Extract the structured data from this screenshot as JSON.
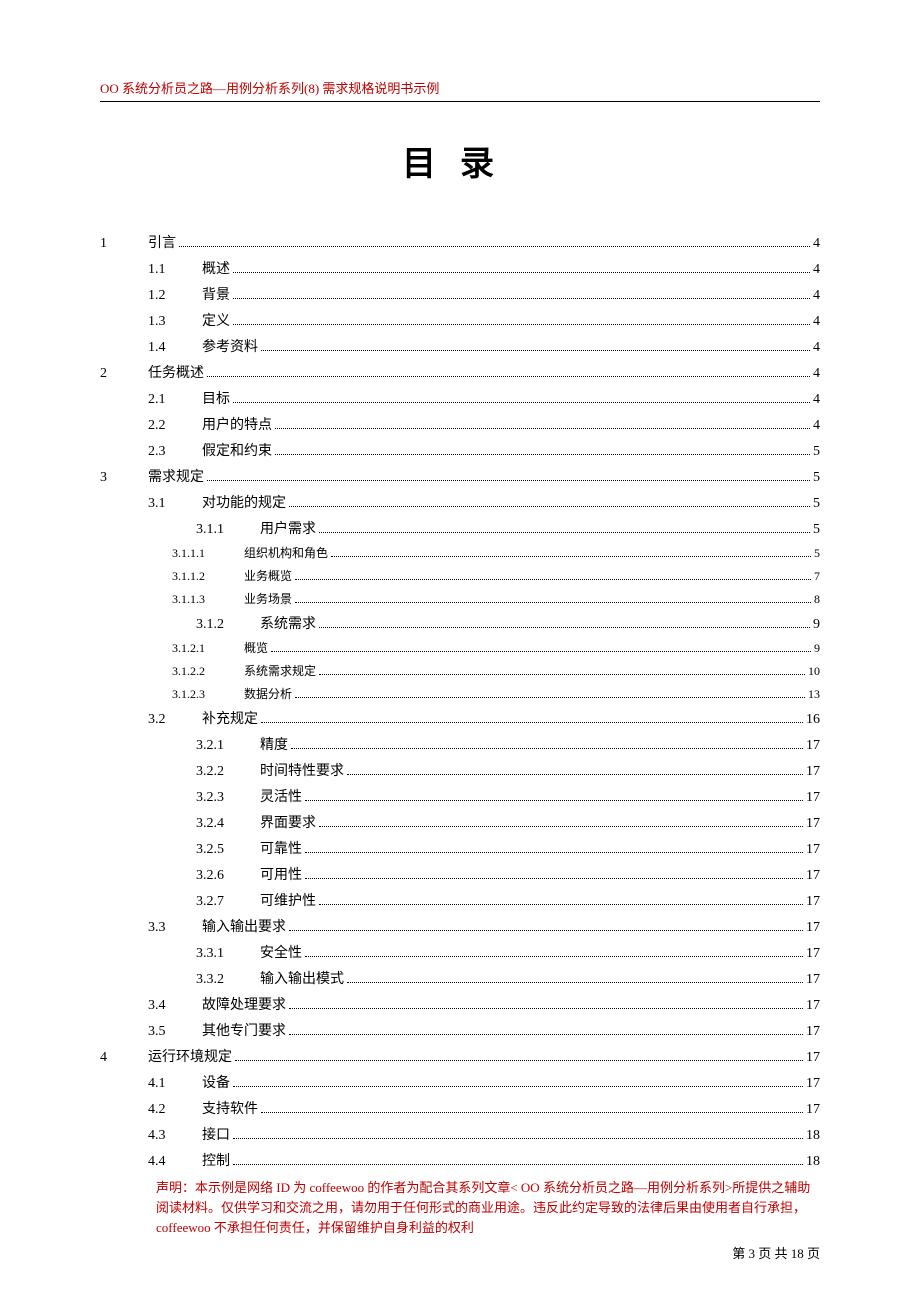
{
  "header": "OO 系统分析员之路—用例分析系列(8)  需求规格说明书示例",
  "title": "目录",
  "toc": [
    {
      "lv": 1,
      "n": "1",
      "t": "引言",
      "p": "4"
    },
    {
      "lv": 2,
      "n": "1.1",
      "t": "概述",
      "p": "4"
    },
    {
      "lv": 2,
      "n": "1.2",
      "t": "背景",
      "p": "4"
    },
    {
      "lv": 2,
      "n": "1.3",
      "t": "定义",
      "p": "4"
    },
    {
      "lv": 2,
      "n": "1.4",
      "t": "参考资料",
      "p": "4"
    },
    {
      "lv": 1,
      "n": "2",
      "t": "任务概述",
      "p": "4"
    },
    {
      "lv": 2,
      "n": "2.1",
      "t": "目标",
      "p": "4"
    },
    {
      "lv": 2,
      "n": "2.2",
      "t": "用户的特点",
      "p": "4"
    },
    {
      "lv": 2,
      "n": "2.3",
      "t": "假定和约束",
      "p": "5"
    },
    {
      "lv": 1,
      "n": "3",
      "t": "需求规定",
      "p": "5"
    },
    {
      "lv": 2,
      "n": "3.1",
      "t": "对功能的规定",
      "p": "5"
    },
    {
      "lv": 3,
      "n": "3.1.1",
      "t": "用户需求",
      "p": "5"
    },
    {
      "lv": 4,
      "n": "3.1.1.1",
      "t": "组织机构和角色",
      "p": "5"
    },
    {
      "lv": 4,
      "n": "3.1.1.2",
      "t": "业务概览",
      "p": "7"
    },
    {
      "lv": 4,
      "n": "3.1.1.3",
      "t": "业务场景",
      "p": "8"
    },
    {
      "lv": 3,
      "n": "3.1.2",
      "t": "系统需求",
      "p": "9"
    },
    {
      "lv": 4,
      "n": "3.1.2.1",
      "t": "概览",
      "p": "9"
    },
    {
      "lv": 4,
      "n": "3.1.2.2",
      "t": "系统需求规定",
      "p": "10"
    },
    {
      "lv": 4,
      "n": "3.1.2.3",
      "t": "数据分析",
      "p": "13"
    },
    {
      "lv": 2,
      "n": "3.2",
      "t": "补充规定",
      "p": "16"
    },
    {
      "lv": 3,
      "n": "3.2.1",
      "t": "精度",
      "p": "17"
    },
    {
      "lv": 3,
      "n": "3.2.2",
      "t": "时间特性要求",
      "p": "17"
    },
    {
      "lv": 3,
      "n": "3.2.3",
      "t": "灵活性",
      "p": "17"
    },
    {
      "lv": 3,
      "n": "3.2.4",
      "t": "界面要求",
      "p": "17"
    },
    {
      "lv": 3,
      "n": "3.2.5",
      "t": "可靠性",
      "p": "17"
    },
    {
      "lv": 3,
      "n": "3.2.6",
      "t": "可用性",
      "p": "17"
    },
    {
      "lv": 3,
      "n": "3.2.7",
      "t": "可维护性",
      "p": "17"
    },
    {
      "lv": 2,
      "n": "3.3",
      "t": "输入输出要求",
      "p": "17"
    },
    {
      "lv": 3,
      "n": "3.3.1",
      "t": "安全性",
      "p": "17"
    },
    {
      "lv": 3,
      "n": "3.3.2",
      "t": "输入输出模式",
      "p": "17"
    },
    {
      "lv": 2,
      "n": "3.4",
      "t": "故障处理要求",
      "p": "17"
    },
    {
      "lv": 2,
      "n": "3.5",
      "t": "其他专门要求",
      "p": "17"
    },
    {
      "lv": 1,
      "n": "4",
      "t": "运行环境规定",
      "p": "17"
    },
    {
      "lv": 2,
      "n": "4.1",
      "t": "设备",
      "p": "17"
    },
    {
      "lv": 2,
      "n": "4.2",
      "t": "支持软件",
      "p": "17"
    },
    {
      "lv": 2,
      "n": "4.3",
      "t": "接口",
      "p": "18"
    },
    {
      "lv": 2,
      "n": "4.4",
      "t": "控制",
      "p": "18"
    }
  ],
  "disclaimer": "声明：本示例是网络 ID 为 coffeewoo 的作者为配合其系列文章< OO 系统分析员之路—用例分析系列>所提供之辅助阅读材料。仅供学习和交流之用，请勿用于任何形式的商业用途。违反此约定导致的法律后果由使用者自行承担，coffeewoo 不承担任何责任，并保留维护自身利益的权利",
  "footer": "第 3 页 共 18 页"
}
